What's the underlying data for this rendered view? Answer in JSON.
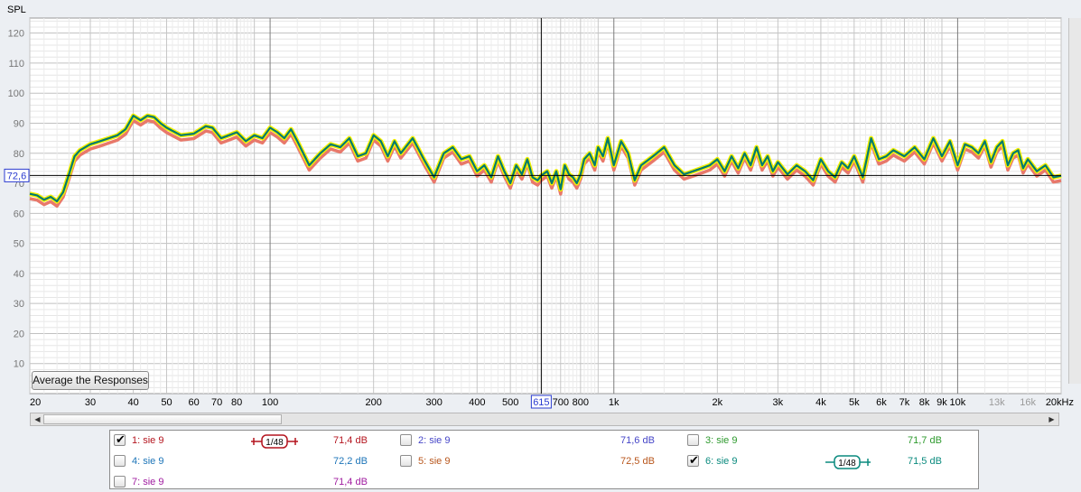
{
  "chart_data": {
    "type": "line",
    "ylabel": "SPL",
    "xunit": "Hz",
    "xscale": "log",
    "xlim": [
      20,
      20000
    ],
    "ylim": [
      0,
      125
    ],
    "yticks": [
      10,
      20,
      30,
      40,
      50,
      60,
      70,
      80,
      90,
      100,
      110,
      120
    ],
    "xticks": [
      {
        "f": 20,
        "label": "20"
      },
      {
        "f": 30,
        "label": "30"
      },
      {
        "f": 40,
        "label": "40"
      },
      {
        "f": 50,
        "label": "50"
      },
      {
        "f": 60,
        "label": "60"
      },
      {
        "f": 70,
        "label": "70"
      },
      {
        "f": 80,
        "label": "80"
      },
      {
        "f": 100,
        "label": "100"
      },
      {
        "f": 200,
        "label": "200"
      },
      {
        "f": 300,
        "label": "300"
      },
      {
        "f": 400,
        "label": "400"
      },
      {
        "f": 500,
        "label": "500"
      },
      {
        "f": 700,
        "label": "700"
      },
      {
        "f": 800,
        "label": "800"
      },
      {
        "f": 1000,
        "label": "1k"
      },
      {
        "f": 2000,
        "label": "2k"
      },
      {
        "f": 3000,
        "label": "3k"
      },
      {
        "f": 4000,
        "label": "4k"
      },
      {
        "f": 5000,
        "label": "5k"
      },
      {
        "f": 6000,
        "label": "6k"
      },
      {
        "f": 7000,
        "label": "7k"
      },
      {
        "f": 8000,
        "label": "8k"
      },
      {
        "f": 9000,
        "label": "9k"
      },
      {
        "f": 10000,
        "label": "10k"
      },
      {
        "f": 13000,
        "label": "13k",
        "grey": true
      },
      {
        "f": 16000,
        "label": "16k",
        "grey": true
      },
      {
        "f": 20000,
        "label": "20kHz"
      }
    ],
    "cursor": {
      "freq": 615,
      "freq_label": "615",
      "spl": 72.6,
      "spl_label": "72,6"
    },
    "grid": true,
    "series": [
      {
        "name": "1: sie 9",
        "color": "#e8786a",
        "offset": -1.6
      },
      {
        "name": "6: sie 9",
        "color": "#007a6e",
        "offset": 0
      }
    ],
    "x": [
      20,
      21,
      22,
      23,
      24,
      25,
      26,
      27,
      28,
      30,
      32,
      34,
      36,
      38,
      40,
      42,
      44,
      46,
      48,
      50,
      55,
      60,
      65,
      68,
      72,
      76,
      80,
      85,
      90,
      95,
      100,
      105,
      110,
      115,
      120,
      130,
      140,
      150,
      160,
      170,
      180,
      190,
      200,
      210,
      220,
      230,
      240,
      260,
      280,
      300,
      320,
      340,
      360,
      380,
      400,
      420,
      440,
      460,
      480,
      500,
      520,
      540,
      560,
      580,
      600,
      615,
      640,
      660,
      680,
      700,
      720,
      740,
      760,
      780,
      800,
      820,
      850,
      880,
      900,
      930,
      960,
      1000,
      1050,
      1100,
      1150,
      1200,
      1300,
      1400,
      1500,
      1600,
      1700,
      1800,
      1900,
      2000,
      2100,
      2200,
      2300,
      2400,
      2500,
      2600,
      2700,
      2800,
      2900,
      3000,
      3200,
      3400,
      3600,
      3800,
      4000,
      4200,
      4400,
      4600,
      4800,
      5000,
      5300,
      5600,
      5900,
      6200,
      6500,
      7000,
      7500,
      8000,
      8500,
      9000,
      9500,
      10000,
      10500,
      11000,
      11500,
      12000,
      12500,
      13000,
      13500,
      14000,
      14500,
      15000,
      15500,
      16000,
      17000,
      18000,
      19000,
      20000
    ],
    "y": [
      66.5,
      66.0,
      64.5,
      65.5,
      64.0,
      67.0,
      73.0,
      79.0,
      81.0,
      83.0,
      84.0,
      85.0,
      86.0,
      88.0,
      92.5,
      91.0,
      92.5,
      92.0,
      90.0,
      88.5,
      86.0,
      86.5,
      89.0,
      88.5,
      85.0,
      86.0,
      87.0,
      84.0,
      86.0,
      85.0,
      88.5,
      87.0,
      85.0,
      88.0,
      84.0,
      76.0,
      80.0,
      83.0,
      82.0,
      85.0,
      79.0,
      80.0,
      86.0,
      84.0,
      79.0,
      84.0,
      80.0,
      85.0,
      78.0,
      72.0,
      80.0,
      82.0,
      78.0,
      79.0,
      74.0,
      76.0,
      72.0,
      79.0,
      74.0,
      70.0,
      76.0,
      73.0,
      78.0,
      72.0,
      71.0,
      72.6,
      74.0,
      70.0,
      74.0,
      68.0,
      76.0,
      73.0,
      72.0,
      70.0,
      73.0,
      78.0,
      80.0,
      76.0,
      82.0,
      79.0,
      85.0,
      76.0,
      84.0,
      80.0,
      71.0,
      76.0,
      79.0,
      82.0,
      76.0,
      73.0,
      74.0,
      75.0,
      76.0,
      78.0,
      74.0,
      79.0,
      75.0,
      80.0,
      76.0,
      82.0,
      76.0,
      79.0,
      74.0,
      77.0,
      73.0,
      76.0,
      74.0,
      71.0,
      78.0,
      74.0,
      72.0,
      77.0,
      75.0,
      79.0,
      72.0,
      85.0,
      78.0,
      79.0,
      81.0,
      79.0,
      82.0,
      78.0,
      85.0,
      79.0,
      84.0,
      76.0,
      83.0,
      82.0,
      80.0,
      84.0,
      77.0,
      82.0,
      84.0,
      76.0,
      80.0,
      81.0,
      75.0,
      78.0,
      74.0,
      76.0,
      72.0,
      72.5
    ]
  },
  "ui": {
    "avg_button": "Average the Responses"
  },
  "legend": [
    {
      "name": "1: sie 9",
      "checked": true,
      "color": "#b4141e",
      "smoothing": "1/48",
      "value": "71,4 dB"
    },
    {
      "name": "2: sie 9",
      "checked": false,
      "color": "#4646c8",
      "value": "71,6 dB"
    },
    {
      "name": "3: sie 9",
      "checked": false,
      "color": "#2e9a2e",
      "value": "71,7 dB"
    },
    {
      "name": "4: sie 9",
      "checked": false,
      "color": "#1c74b8",
      "value": "72,2 dB"
    },
    {
      "name": "5: sie 9",
      "checked": false,
      "color": "#b8561c",
      "value": "72,5 dB"
    },
    {
      "name": "6: sie 9",
      "checked": true,
      "color": "#0a8a7e",
      "smoothing": "1/48",
      "value": "71,5 dB"
    },
    {
      "name": "7: sie 9",
      "checked": false,
      "color": "#a01ca0",
      "value": "71,4 dB"
    }
  ]
}
